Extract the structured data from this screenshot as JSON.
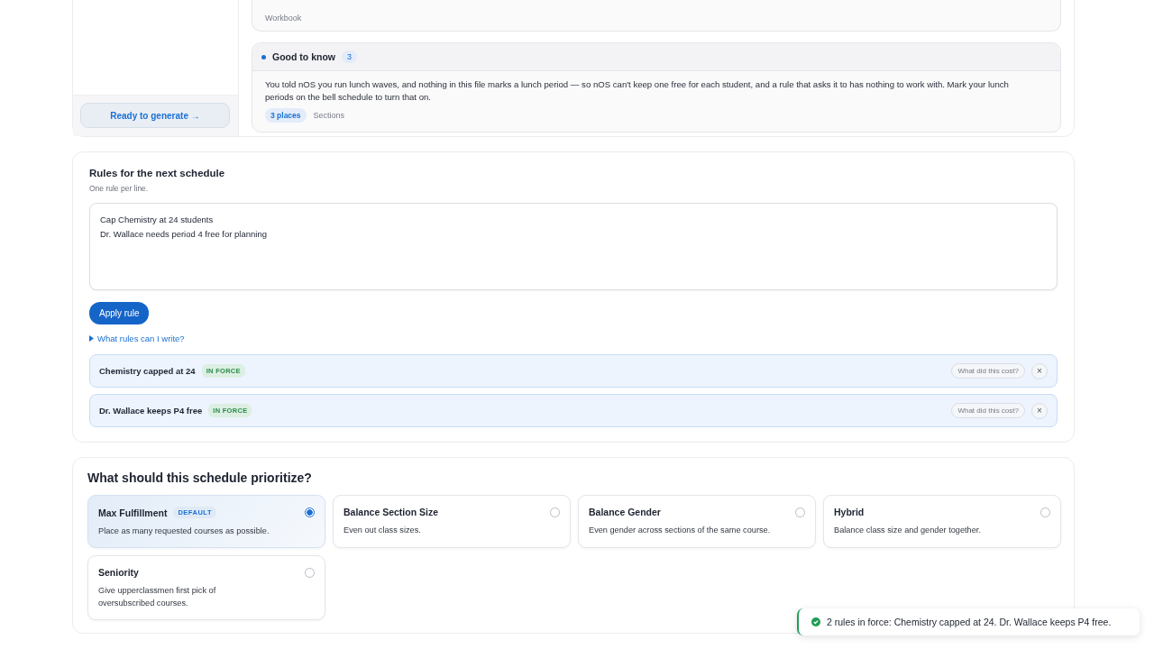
{
  "sidebar": {
    "generate_button": "Ready to generate →"
  },
  "notices": [
    {
      "kind": "source",
      "tag": "Workbook"
    },
    {
      "kind": "info",
      "title": "Good to know",
      "count": "3",
      "text": "You told nOS you run lunch waves, and nothing in this file marks a lunch period — so nOS can't keep one free for each student, and a rule that asks it to has nothing to work with. Mark your lunch periods on the bell schedule to turn that on.",
      "places": "3 places",
      "tag": "Sections"
    }
  ],
  "rules": {
    "title": "Rules for the next schedule",
    "hint": "One rule per line.",
    "value": "Cap Chemistry at 24 students\nDr. Wallace needs period 4 free for planning",
    "apply_button": "Apply rule",
    "help_link": "What rules can I write?",
    "expanded": false,
    "items": [
      {
        "label": "Chemistry capped at 24",
        "status": "IN FORCE",
        "cost_button": "What did this cost?",
        "remove": "×"
      },
      {
        "label": "Dr. Wallace keeps P4 free",
        "status": "IN FORCE",
        "cost_button": "What did this cost?",
        "remove": "×"
      }
    ]
  },
  "priority": {
    "title": "What should this schedule prioritize?",
    "options": [
      {
        "title": "Max Fulfillment",
        "badge": "DEFAULT",
        "text": "Place as many requested courses as possible.",
        "selected": true
      },
      {
        "title": "Balance Section Size",
        "text": "Even out class sizes.",
        "selected": false
      },
      {
        "title": "Balance Gender",
        "text": "Even gender across sections of the same course.",
        "selected": false
      },
      {
        "title": "Hybrid",
        "text": "Balance class size and gender together.",
        "selected": false
      },
      {
        "title": "Seniority",
        "text": "Give upperclassmen first pick of oversubscribed courses.",
        "selected": false
      }
    ]
  },
  "toast": {
    "text": "2 rules in force: Chemistry capped at 24. Dr. Wallace keeps P4 free."
  }
}
